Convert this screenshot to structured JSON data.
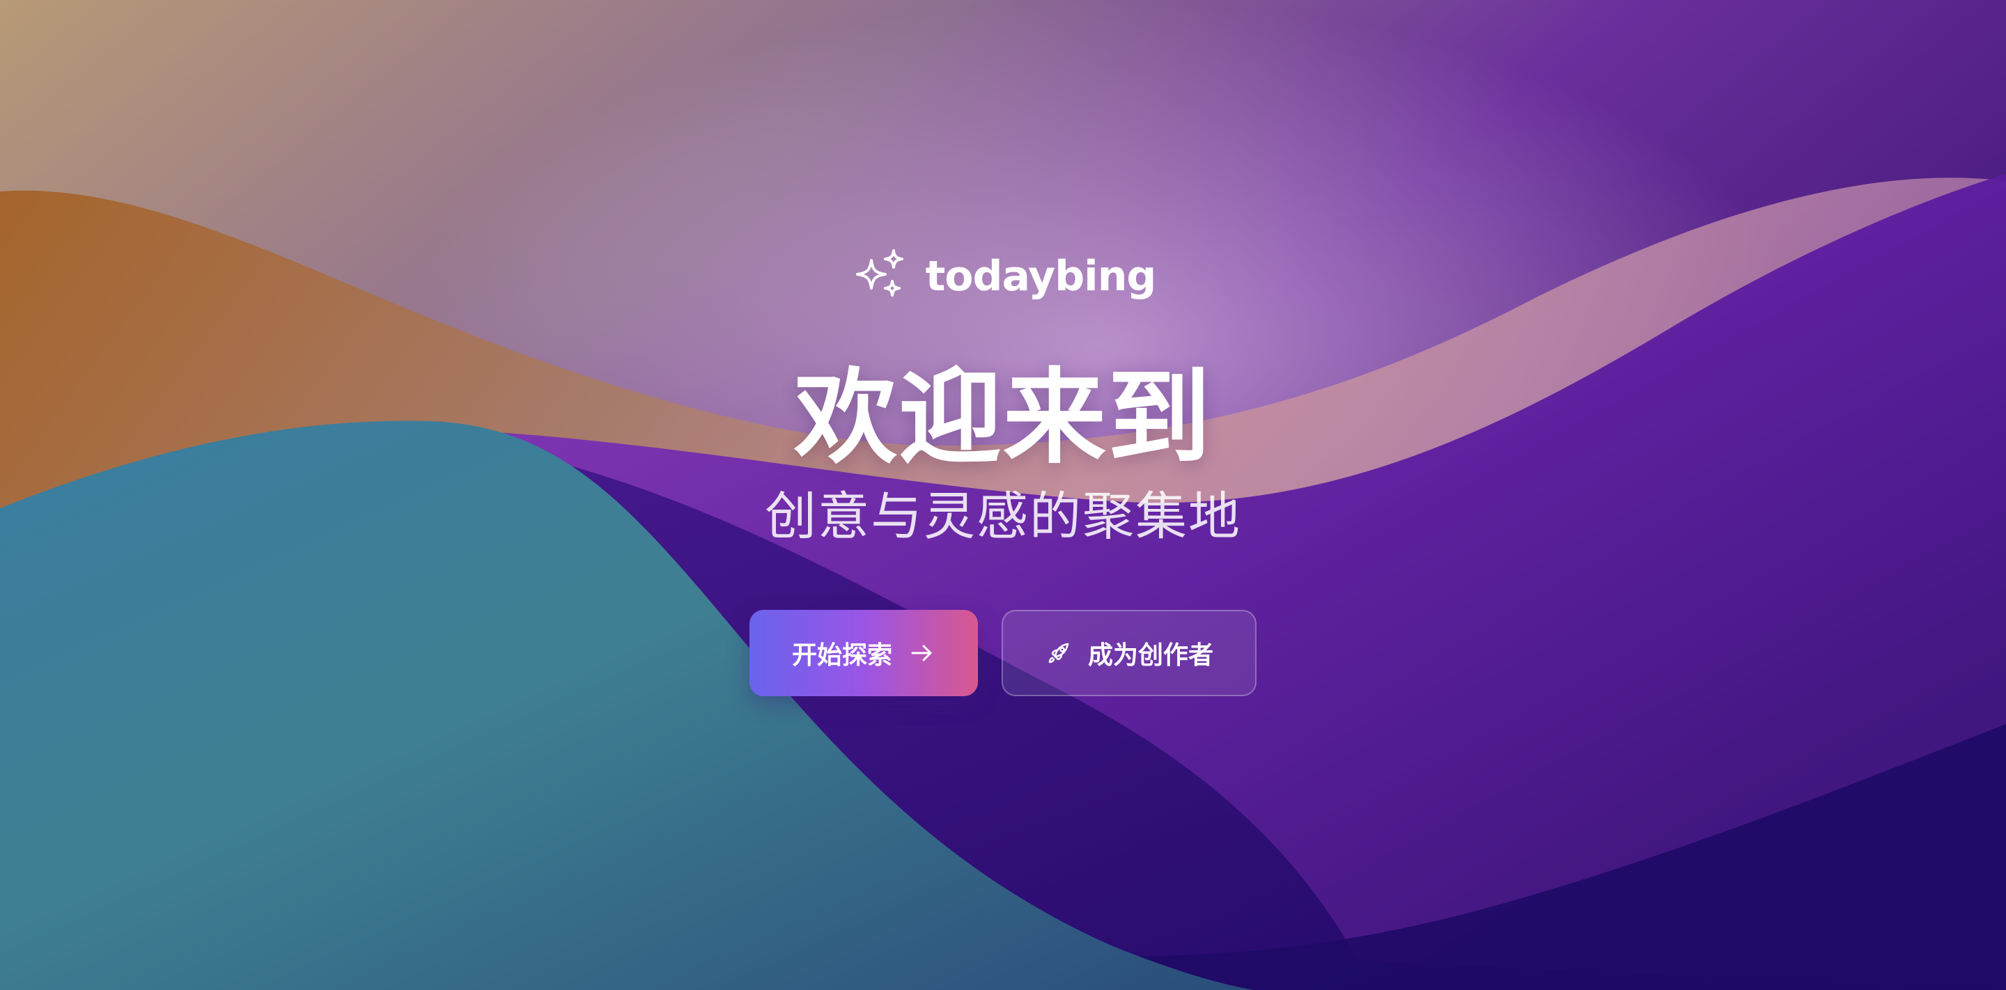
{
  "brand": {
    "name": "todaybing",
    "icon": "sparkles-icon"
  },
  "hero": {
    "title": "欢迎来到",
    "subtitle": "创意与灵感的聚集地"
  },
  "actions": {
    "primary": {
      "label": "开始探索",
      "icon": "arrow-right-icon",
      "gradient_start": "#6a63ec",
      "gradient_end": "#d9588e"
    },
    "secondary": {
      "label": "成为创作者",
      "icon": "rocket-icon"
    }
  },
  "theme": {
    "background_colors": [
      "#a97a45",
      "#3f7f98",
      "#6a2fa0",
      "#3a1580"
    ]
  }
}
